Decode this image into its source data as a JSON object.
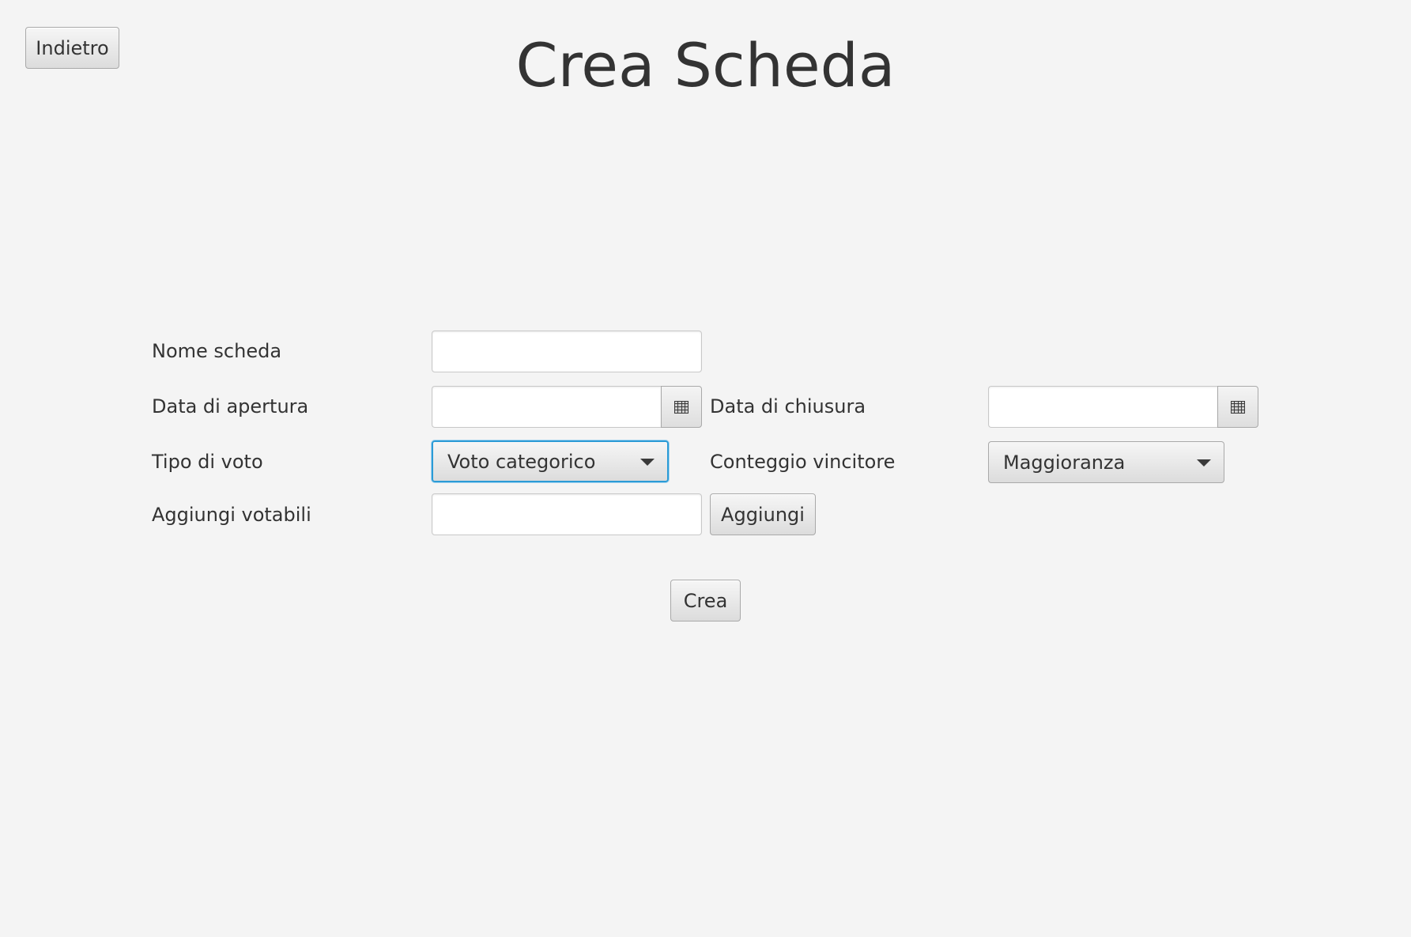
{
  "header": {
    "back_label": "Indietro",
    "title": "Crea Scheda"
  },
  "form": {
    "name_label": "Nome scheda",
    "name_value": "",
    "open_date_label": "Data di apertura",
    "open_date_value": "",
    "close_date_label": "Data di chiusura",
    "close_date_value": "",
    "vote_type_label": "Tipo di voto",
    "vote_type_value": "Voto categorico",
    "winner_count_label": "Conteggio vincitore",
    "winner_count_value": "Maggioranza",
    "add_votables_label": "Aggiungi votabili",
    "add_votables_value": "",
    "add_button_label": "Aggiungi",
    "create_button_label": "Crea"
  },
  "icons": {
    "calendar": "calendar-icon",
    "dropdown": "chevron-down-icon"
  },
  "colors": {
    "background": "#f4f4f4",
    "focus": "#2b9bd6",
    "text": "#333333"
  }
}
